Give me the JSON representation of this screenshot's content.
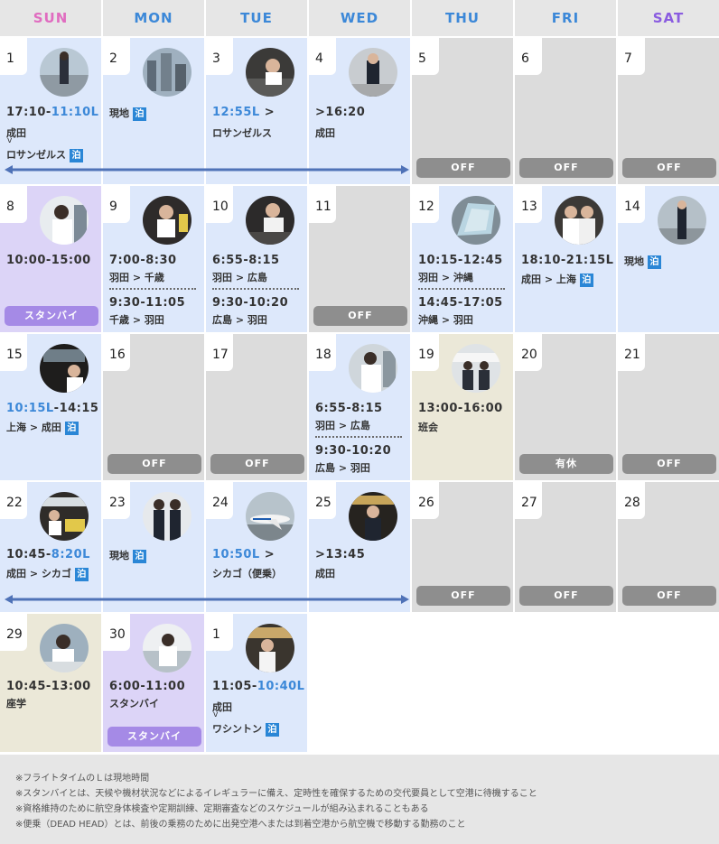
{
  "days_of_week": [
    "SUN",
    "MON",
    "TUE",
    "WED",
    "THU",
    "FRI",
    "SAT"
  ],
  "colors": {
    "sun": "#e06cc0",
    "weekday": "#3c88d8",
    "sat": "#8a5ce0",
    "badge": "#2a86d6",
    "local_time": "#3c88d8",
    "off_button": "#8e8e8e",
    "standby_button": "#a58ae6"
  },
  "stay_label": "泊",
  "cells": {
    "d1": {
      "num": "1",
      "time_a": "17:10-",
      "time_b": "11:10L",
      "l1": "成田",
      "l2": "ロサンゼルス"
    },
    "d2": {
      "num": "2",
      "l1": "現地"
    },
    "d3": {
      "num": "3",
      "time_a": "12:55L",
      "time_b": " >",
      "l1": "ロサンゼルス"
    },
    "d4": {
      "num": "4",
      "time_a": ">16:20",
      "l1": "成田"
    },
    "d5": {
      "num": "5",
      "btn": "OFF"
    },
    "d6": {
      "num": "6",
      "btn": "OFF"
    },
    "d7": {
      "num": "7",
      "btn": "OFF"
    },
    "d8": {
      "num": "8",
      "time_a": "10:00-15:00",
      "btn": "スタンバイ"
    },
    "d9": {
      "num": "9",
      "time_a": "7:00-8:30",
      "l1": "羽田 > 千歳",
      "time_c": "9:30-11:05",
      "l2": "千歳 > 羽田"
    },
    "d10": {
      "num": "10",
      "time_a": "6:55-8:15",
      "l1": "羽田 > 広島",
      "time_c": "9:30-10:20",
      "l2": "広島 > 羽田"
    },
    "d11": {
      "num": "11",
      "btn": "OFF"
    },
    "d12": {
      "num": "12",
      "time_a": "10:15-12:45",
      "l1": "羽田 > 沖縄",
      "time_c": "14:45-17:05",
      "l2": "沖縄 > 羽田"
    },
    "d13": {
      "num": "13",
      "time_a": "18:10-21:15L",
      "l1": "成田 > 上海"
    },
    "d14": {
      "num": "14",
      "l1": "現地"
    },
    "d15": {
      "num": "15",
      "time_a": "10:15L",
      "time_b": "-14:15",
      "l1": "上海 > 成田"
    },
    "d16": {
      "num": "16",
      "btn": "OFF"
    },
    "d17": {
      "num": "17",
      "btn": "OFF"
    },
    "d18": {
      "num": "18",
      "time_a": "6:55-8:15",
      "l1": "羽田 > 広島",
      "time_c": "9:30-10:20",
      "l2": "広島 > 羽田"
    },
    "d19": {
      "num": "19",
      "time_a": "13:00-16:00",
      "l1": "班会"
    },
    "d20": {
      "num": "20",
      "btn": "有休"
    },
    "d21": {
      "num": "21",
      "btn": "OFF"
    },
    "d22": {
      "num": "22",
      "time_a": "10:45-",
      "time_b": "8:20L",
      "l1": "成田 > シカゴ"
    },
    "d23": {
      "num": "23",
      "l1": "現地"
    },
    "d24": {
      "num": "24",
      "time_a": "10:50L",
      "time_b": " >",
      "l1": "シカゴ（便乗）"
    },
    "d25": {
      "num": "25",
      "time_a": ">13:45",
      "l1": "成田"
    },
    "d26": {
      "num": "26",
      "btn": "OFF"
    },
    "d27": {
      "num": "27",
      "btn": "OFF"
    },
    "d28": {
      "num": "28",
      "btn": "OFF"
    },
    "d29": {
      "num": "29",
      "time_a": "10:45-13:00",
      "l1": "座学"
    },
    "d30": {
      "num": "30",
      "time_a": "6:00-11:00",
      "l1": "スタンバイ",
      "btn": "スタンバイ"
    },
    "d31": {
      "num": "1",
      "time_a": "11:05-",
      "time_b": "10:40L",
      "l1": "成田",
      "l2": "ワシントン"
    }
  },
  "notes": [
    "※フライトタイムのＬは現地時間",
    "※スタンバイとは、天候や機材状況などによるイレギュラーに備え、定時性を確保するための交代要員として空港に待機すること",
    "※資格維持のために航空身体検査や定期訓練、定期審査などのスケジュールが組み込まれることもある",
    "※便乗（DEAD HEAD）とは、前後の乗務のために出発空港へまたは到着空港から航空機で移動する勤務のこと"
  ]
}
